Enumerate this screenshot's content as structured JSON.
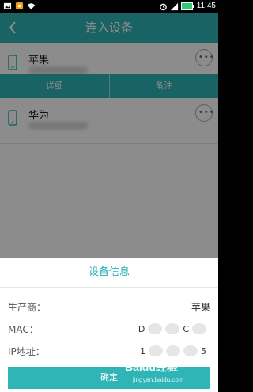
{
  "status_bar": {
    "time": "11:45",
    "icons": [
      "image-icon",
      "notification-icon",
      "wifi-icon",
      "alarm-icon",
      "signal-icon",
      "battery-icon"
    ]
  },
  "header": {
    "title": "连入设备"
  },
  "devices": [
    {
      "name": "苹果"
    },
    {
      "name": "华为"
    }
  ],
  "actions": {
    "details_label": "详细",
    "note_label": "备注"
  },
  "dialog": {
    "title": "设备信息",
    "rows": [
      {
        "label": "生产商：",
        "value": "苹果"
      },
      {
        "label": "MAC：",
        "value_start": "D",
        "value_end": "C"
      },
      {
        "label": "IP地址：",
        "value_start": "1",
        "value_end": "5"
      }
    ],
    "confirm_label": "确定"
  },
  "watermark": {
    "text": "Baidu经验",
    "subtext": "jingyan.baidu.com"
  },
  "colors": {
    "primary": "#2fb5b6",
    "text_dark": "#222222",
    "overlay": "rgba(0,0,0,0.45)"
  }
}
